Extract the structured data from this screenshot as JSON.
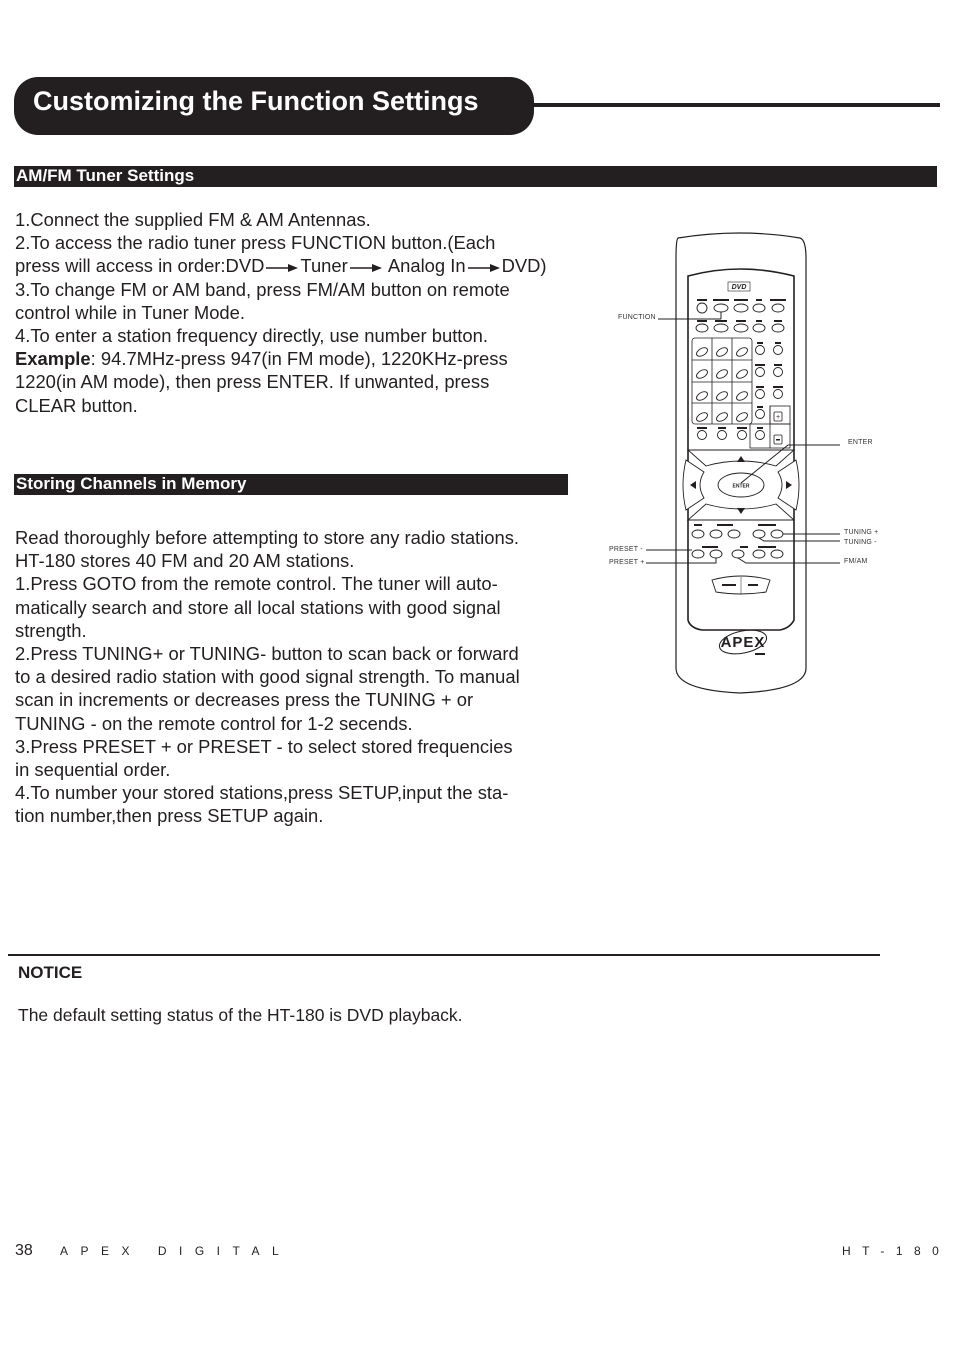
{
  "page": {
    "title": "Customizing the Function Settings"
  },
  "amfm": {
    "heading": "AM/FM Tuner Settings",
    "lines": {
      "l1": "1.Connect the supplied FM & AM Antennas.",
      "l2": "2.To access the radio tuner press FUNCTION button.(Each",
      "l3_prefix": "press will access in order:",
      "order": [
        "DVD",
        "Tuner",
        "Analog In",
        "DVD)"
      ],
      "l4": "3.To change FM or AM band, press FM/AM button on remote",
      "l5": "control while in Tuner Mode.",
      "l6": "4.To enter a station frequency directly, use number button.",
      "example_label": "Example",
      "l7_rest": ": 94.7MHz-press 947(in FM mode), 1220KHz-press",
      "l8": "1220(in AM mode), then press ENTER. If unwanted, press",
      "l9": "CLEAR button."
    }
  },
  "storing": {
    "heading": "Storing Channels in Memory",
    "lines": [
      "Read thoroughly before attempting to store any radio stations.",
      "HT-180 stores 40 FM and 20 AM stations.",
      "1.Press GOTO from the remote control. The tuner will auto-",
      "matically search and store all local stations with good signal",
      "strength.",
      "2.Press TUNING+ or TUNING- button to scan back or forward",
      "to a desired radio station with good signal strength. To manual",
      "scan in increments or decreases press the TUNING + or",
      "TUNING - on the remote control for 1-2 secends.",
      "3.Press PRESET + or PRESET - to select stored frequencies",
      "in sequential order.",
      "4.To number your stored stations,press SETUP,input the sta-",
      "tion number,then press SETUP again."
    ]
  },
  "remote": {
    "callouts": {
      "function": "FUNCTION",
      "enter": "ENTER",
      "tuning_plus": "TUNING +",
      "tuning_minus": "TUNING -",
      "fm_am": "FM/AM",
      "preset_minus": "PRESET -",
      "preset_plus": "PRESET +"
    },
    "center_button": "ENTER",
    "logo": "APEX",
    "badge": "DVD"
  },
  "notice": {
    "title": "NOTICE",
    "text": "The default setting status of the HT-180 is DVD playback."
  },
  "footer": {
    "page_number": "38",
    "brand": "APEX DIGITAL",
    "model": "HT-180"
  }
}
